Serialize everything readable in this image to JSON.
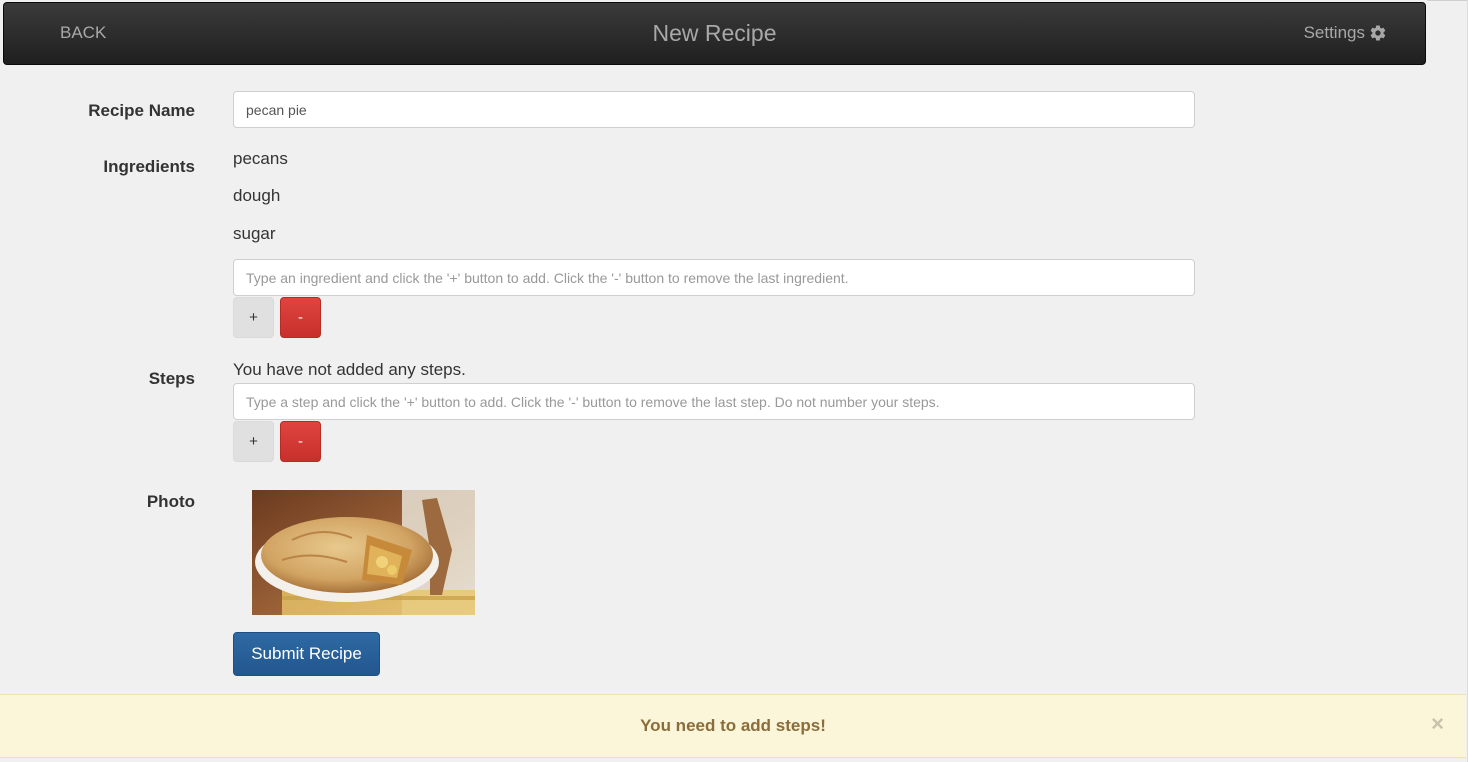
{
  "navbar": {
    "back_label": "BACK",
    "title": "New Recipe",
    "settings_label": "Settings",
    "settings_icon": "gear-icon"
  },
  "form": {
    "recipe_name_label": "Recipe Name",
    "recipe_name_value": "pecan pie",
    "ingredients_label": "Ingredients",
    "ingredients": [
      "pecans",
      "dough",
      "sugar"
    ],
    "ingredient_placeholder": "Type an ingredient and click the '+' button to add. Click the '-' button to remove the last ingredient.",
    "add_label": "+",
    "remove_label": "-",
    "steps_label": "Steps",
    "steps_empty_message": "You have not added any steps.",
    "step_placeholder": "Type a step and click the '+' button to add. Click the '-' button to remove the last step. Do not number your steps.",
    "photo_label": "Photo",
    "submit_label": "Submit Recipe"
  },
  "alert": {
    "message": "You need to add steps!",
    "close_glyph": "×"
  },
  "colors": {
    "navbar_bg": "#2a2a2a",
    "primary": "#22568e",
    "danger": "#d9534f",
    "alert_bg": "#fbf5d9",
    "alert_text": "#8a6d3b"
  }
}
